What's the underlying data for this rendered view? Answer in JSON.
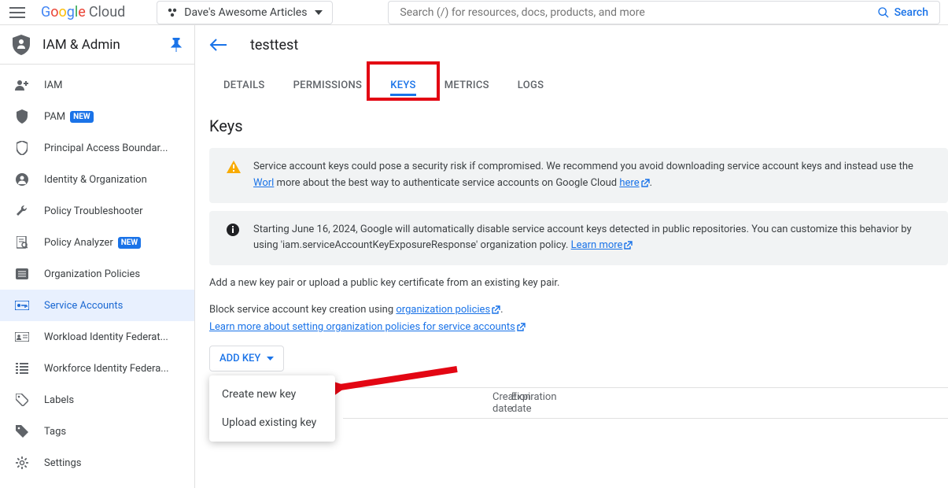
{
  "header": {
    "logo_cloud": "Cloud",
    "project_name": "Dave's Awesome Articles",
    "search_placeholder": "Search (/) for resources, docs, products, and more",
    "search_button": "Search"
  },
  "sidebar": {
    "title": "IAM & Admin",
    "items": [
      {
        "label": "IAM",
        "icon": "person-add-icon"
      },
      {
        "label": "PAM",
        "icon": "shield-icon",
        "badge": "NEW"
      },
      {
        "label": "Principal Access Boundar...",
        "icon": "shield-outline-icon"
      },
      {
        "label": "Identity & Organization",
        "icon": "account-icon"
      },
      {
        "label": "Policy Troubleshooter",
        "icon": "wrench-icon"
      },
      {
        "label": "Policy Analyzer",
        "icon": "document-search-icon",
        "badge": "NEW"
      },
      {
        "label": "Organization Policies",
        "icon": "list-icon"
      },
      {
        "label": "Service Accounts",
        "icon": "key-card-icon",
        "active": true
      },
      {
        "label": "Workload Identity Federat...",
        "icon": "id-card-icon"
      },
      {
        "label": "Workforce Identity Federa...",
        "icon": "list-dense-icon"
      },
      {
        "label": "Labels",
        "icon": "tag-icon"
      },
      {
        "label": "Tags",
        "icon": "tag-filled-icon"
      },
      {
        "label": "Settings",
        "icon": "gear-icon"
      }
    ]
  },
  "page": {
    "title": "testtest",
    "tabs": [
      "DETAILS",
      "PERMISSIONS",
      "KEYS",
      "METRICS",
      "LOGS"
    ],
    "active_tab": "KEYS",
    "section_title": "Keys",
    "alerts": [
      {
        "type": "warning",
        "text_before_link1": "Service account keys could pose a security risk if compromised. We recommend you avoid downloading service account keys and instead use the ",
        "link1": "Worl",
        "text_between": " more about the best way to authenticate service accounts on Google Cloud ",
        "link2": "here"
      },
      {
        "type": "info",
        "text_before": "Starting June 16, 2024, Google will automatically disable service account keys detected in public repositories. You can customize this behavior by using 'iam.serviceAccountKeyExposureResponse' organization policy. ",
        "link": "Learn more"
      }
    ],
    "description": "Add a new key pair or upload a public key certificate from an existing key pair.",
    "block_text_before": "Block service account key creation using ",
    "block_link": "organization policies",
    "learn_more_link": "Learn more about setting organization policies for service accounts",
    "add_key_button": "ADD KEY",
    "dropdown": [
      "Create new key",
      "Upload existing key"
    ],
    "table_headers": [
      "Creation date",
      "Expiration date"
    ]
  }
}
